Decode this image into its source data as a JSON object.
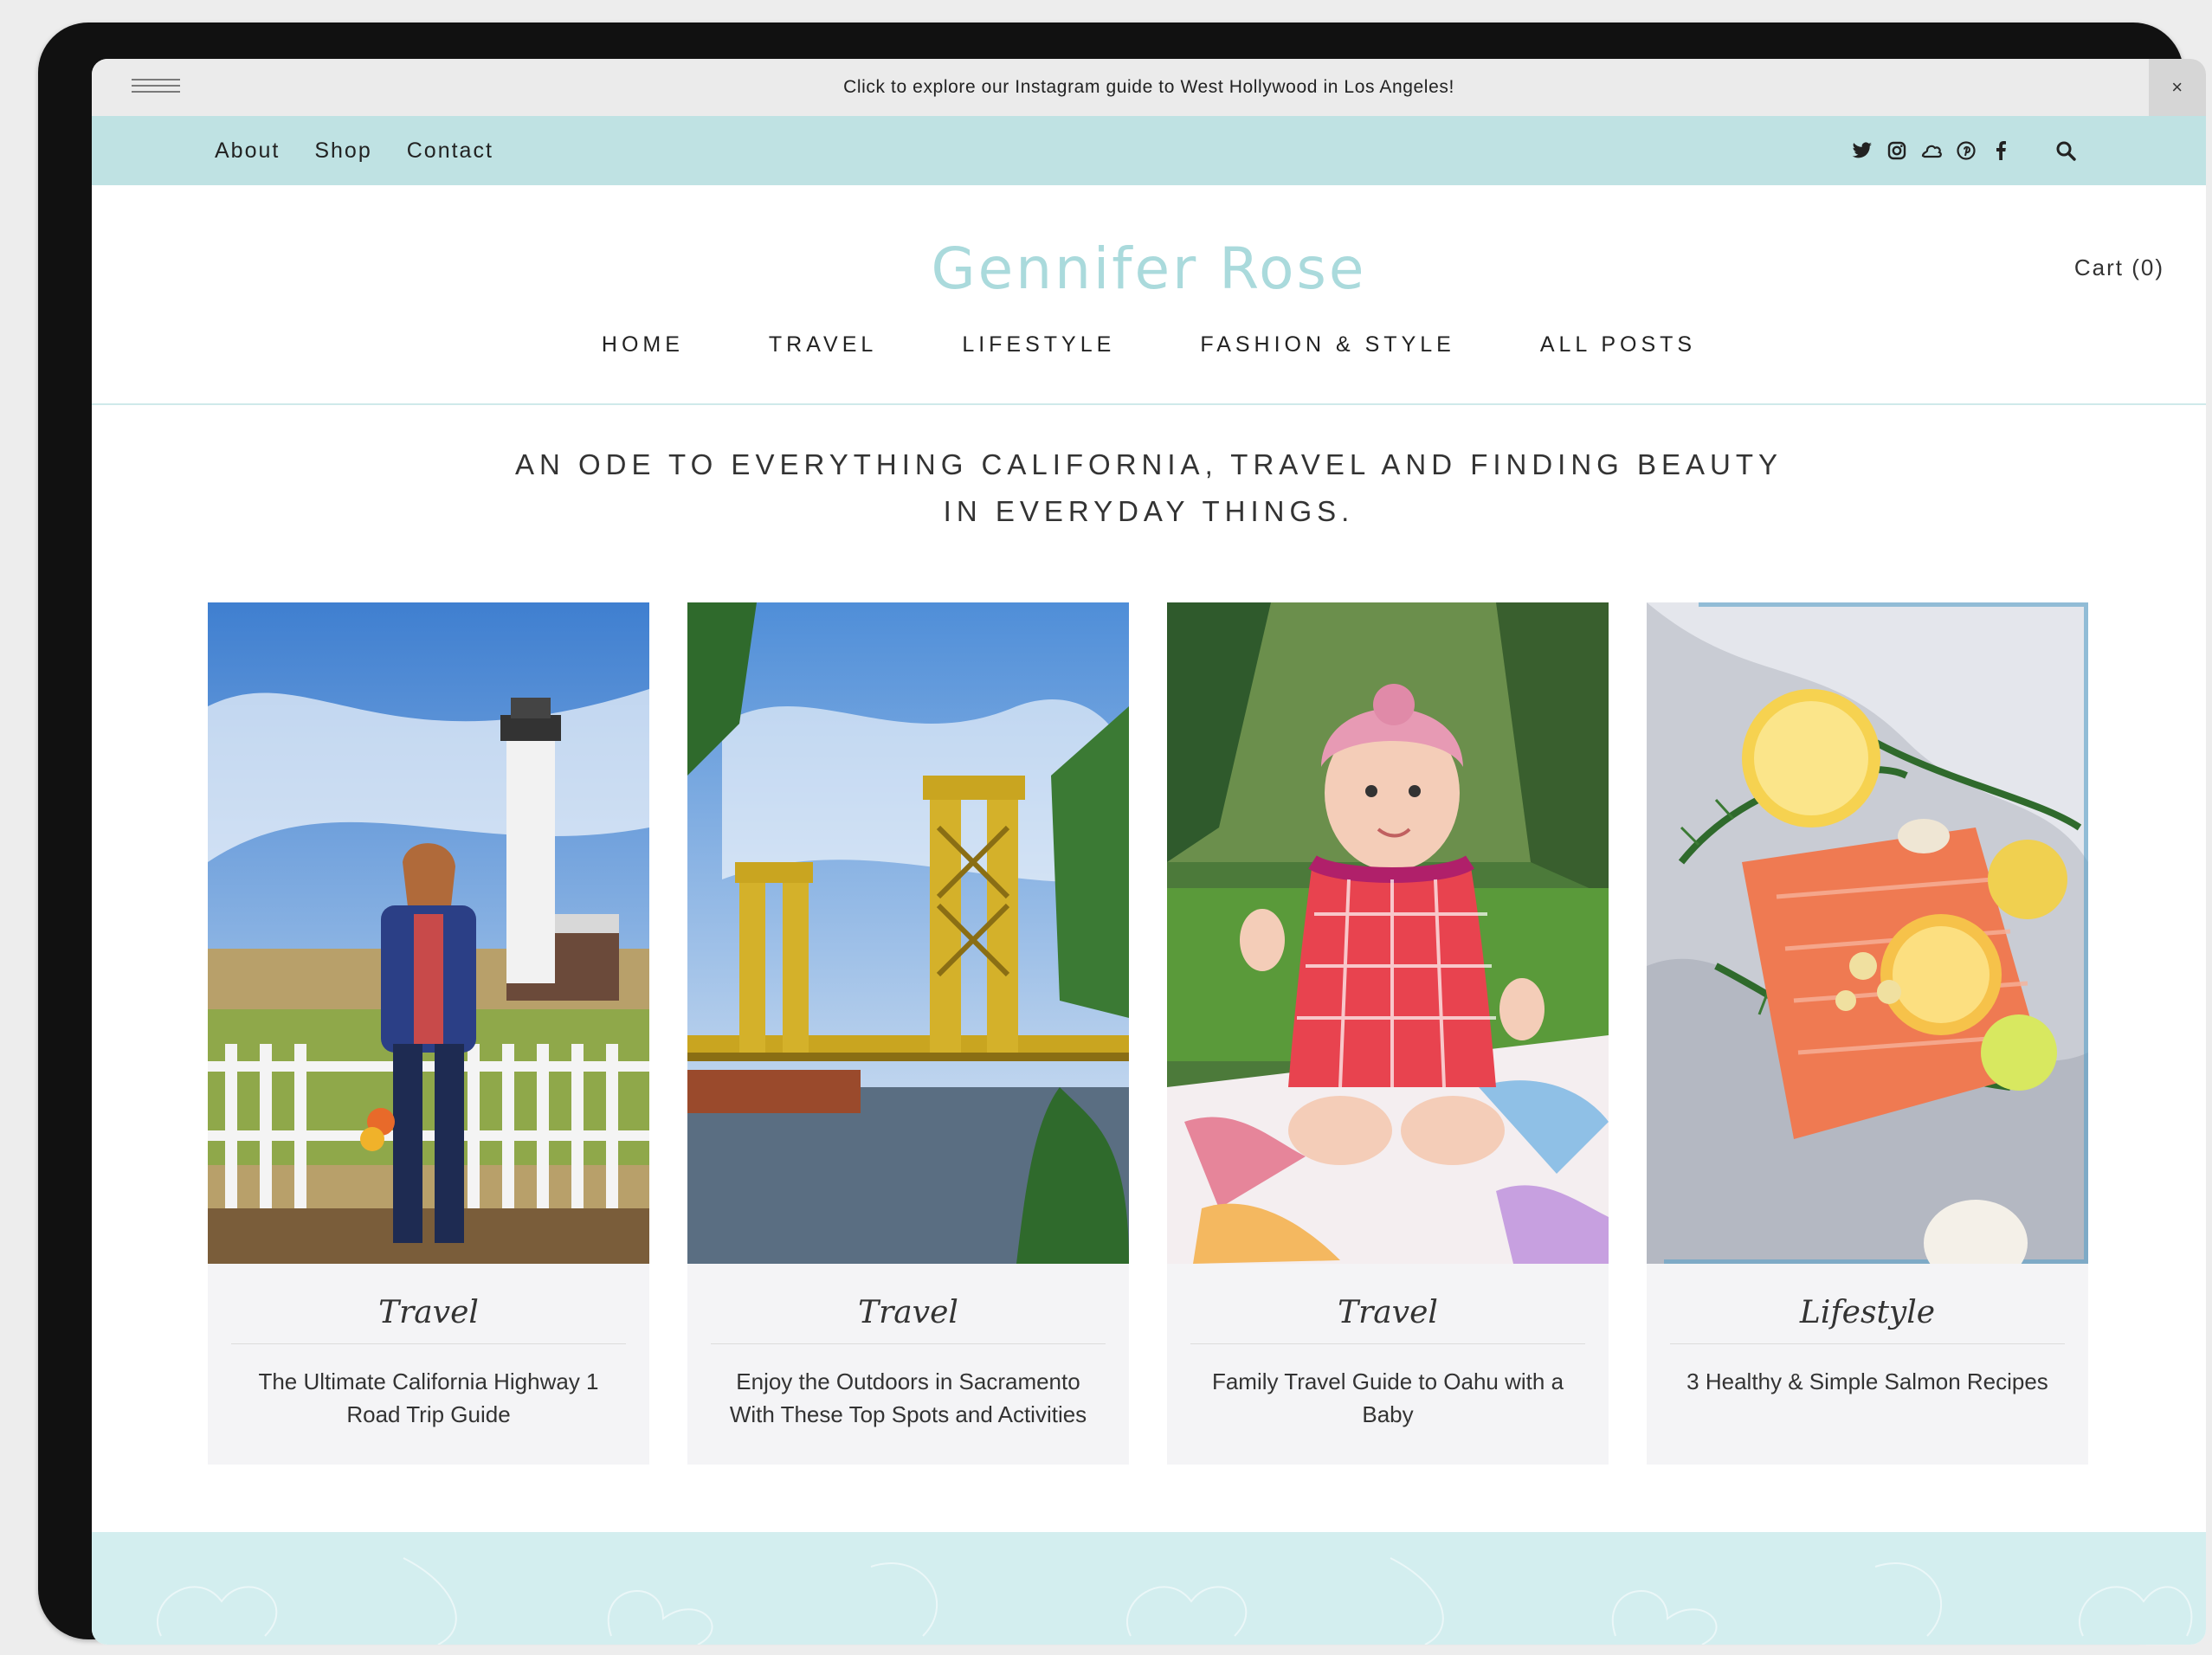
{
  "announcement": {
    "text": "Click to explore our Instagram guide to West Hollywood in Los Angeles!",
    "close": "×"
  },
  "topnav": {
    "links": [
      "About",
      "Shop",
      "Contact"
    ]
  },
  "socials": [
    "twitter-icon",
    "instagram-icon",
    "soundcloud-icon",
    "pinterest-icon",
    "facebook-icon"
  ],
  "brand": "Gennifer Rose",
  "cart": "Cart (0)",
  "mainnav": [
    "HOME",
    "TRAVEL",
    "LIFESTYLE",
    "FASHION & STYLE",
    "ALL POSTS"
  ],
  "tagline": {
    "line1": "AN ODE TO EVERYTHING CALIFORNIA, TRAVEL AND FINDING BEAUTY",
    "line2": "IN EVERYDAY THINGS."
  },
  "posts": [
    {
      "category": "Travel",
      "title": "The Ultimate California Highway 1 Road Trip Guide"
    },
    {
      "category": "Travel",
      "title": "Enjoy the Outdoors in Sacramento With These Top Spots and Activities"
    },
    {
      "category": "Travel",
      "title": "Family Travel Guide to Oahu with a Baby"
    },
    {
      "category": "Lifestyle",
      "title": "3 Healthy & Simple Salmon Recipes"
    }
  ],
  "colors": {
    "brand": "#aadadc",
    "topnav": "#bfe2e3",
    "footer": "#d3eeef"
  }
}
